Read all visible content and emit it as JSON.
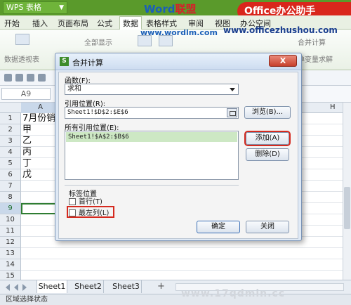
{
  "app": {
    "name": "WPS 表格",
    "watermark_logo_prefix": "Word",
    "watermark_logo_suffix": "联盟",
    "watermark_badge": "Office办公助手",
    "watermark_url1": "www.wordlm.com",
    "watermark_url2": "www.officezhushou.com",
    "watermark_url3": "www.17qdmin.cc"
  },
  "menu": {
    "items": [
      "开始",
      "插入",
      "页面布局",
      "公式",
      "数据",
      "表格样式",
      "审阅",
      "视图",
      "办公空间"
    ],
    "active_index": 4
  },
  "ribbon": {
    "pivot_label": "数据透视表",
    "show_all_label": "全部显示",
    "merge_label": "合并计算",
    "solver_label": "单变量求解"
  },
  "namebox": {
    "value": "A9"
  },
  "grid": {
    "column_a": "A",
    "column_h": "H",
    "rows": [
      "1",
      "2",
      "3",
      "4",
      "5",
      "6",
      "7",
      "8",
      "9",
      "10",
      "11",
      "12",
      "13",
      "14",
      "15"
    ],
    "cells": [
      "7月份销",
      "甲",
      "乙",
      "丙",
      "丁",
      "戊"
    ],
    "selected_row": "9"
  },
  "sheets": {
    "tabs": [
      "Sheet1",
      "Sheet2",
      "Sheet3"
    ],
    "active": 0,
    "add_label": "+"
  },
  "status": {
    "text": "区域选择状态"
  },
  "dialog": {
    "icon_letter": "S",
    "title": "合并计算",
    "close_label": "X",
    "function_label": "函数(F):",
    "function_value": "求和",
    "ref_label": "引用位置(R):",
    "ref_value": "Sheet1!$D$2:$E$6",
    "browse_label": "浏览(B)...",
    "all_refs_label": "所有引用位置(E):",
    "all_refs": [
      "Sheet1!$A$2:$B$6"
    ],
    "add_label": "添加(A)",
    "delete_label": "删除(D)",
    "label_group": "标签位置",
    "top_row_label": "首行(T)",
    "left_col_label": "最左列(L)",
    "ok_label": "确定",
    "close_btn_label": "关闭"
  }
}
